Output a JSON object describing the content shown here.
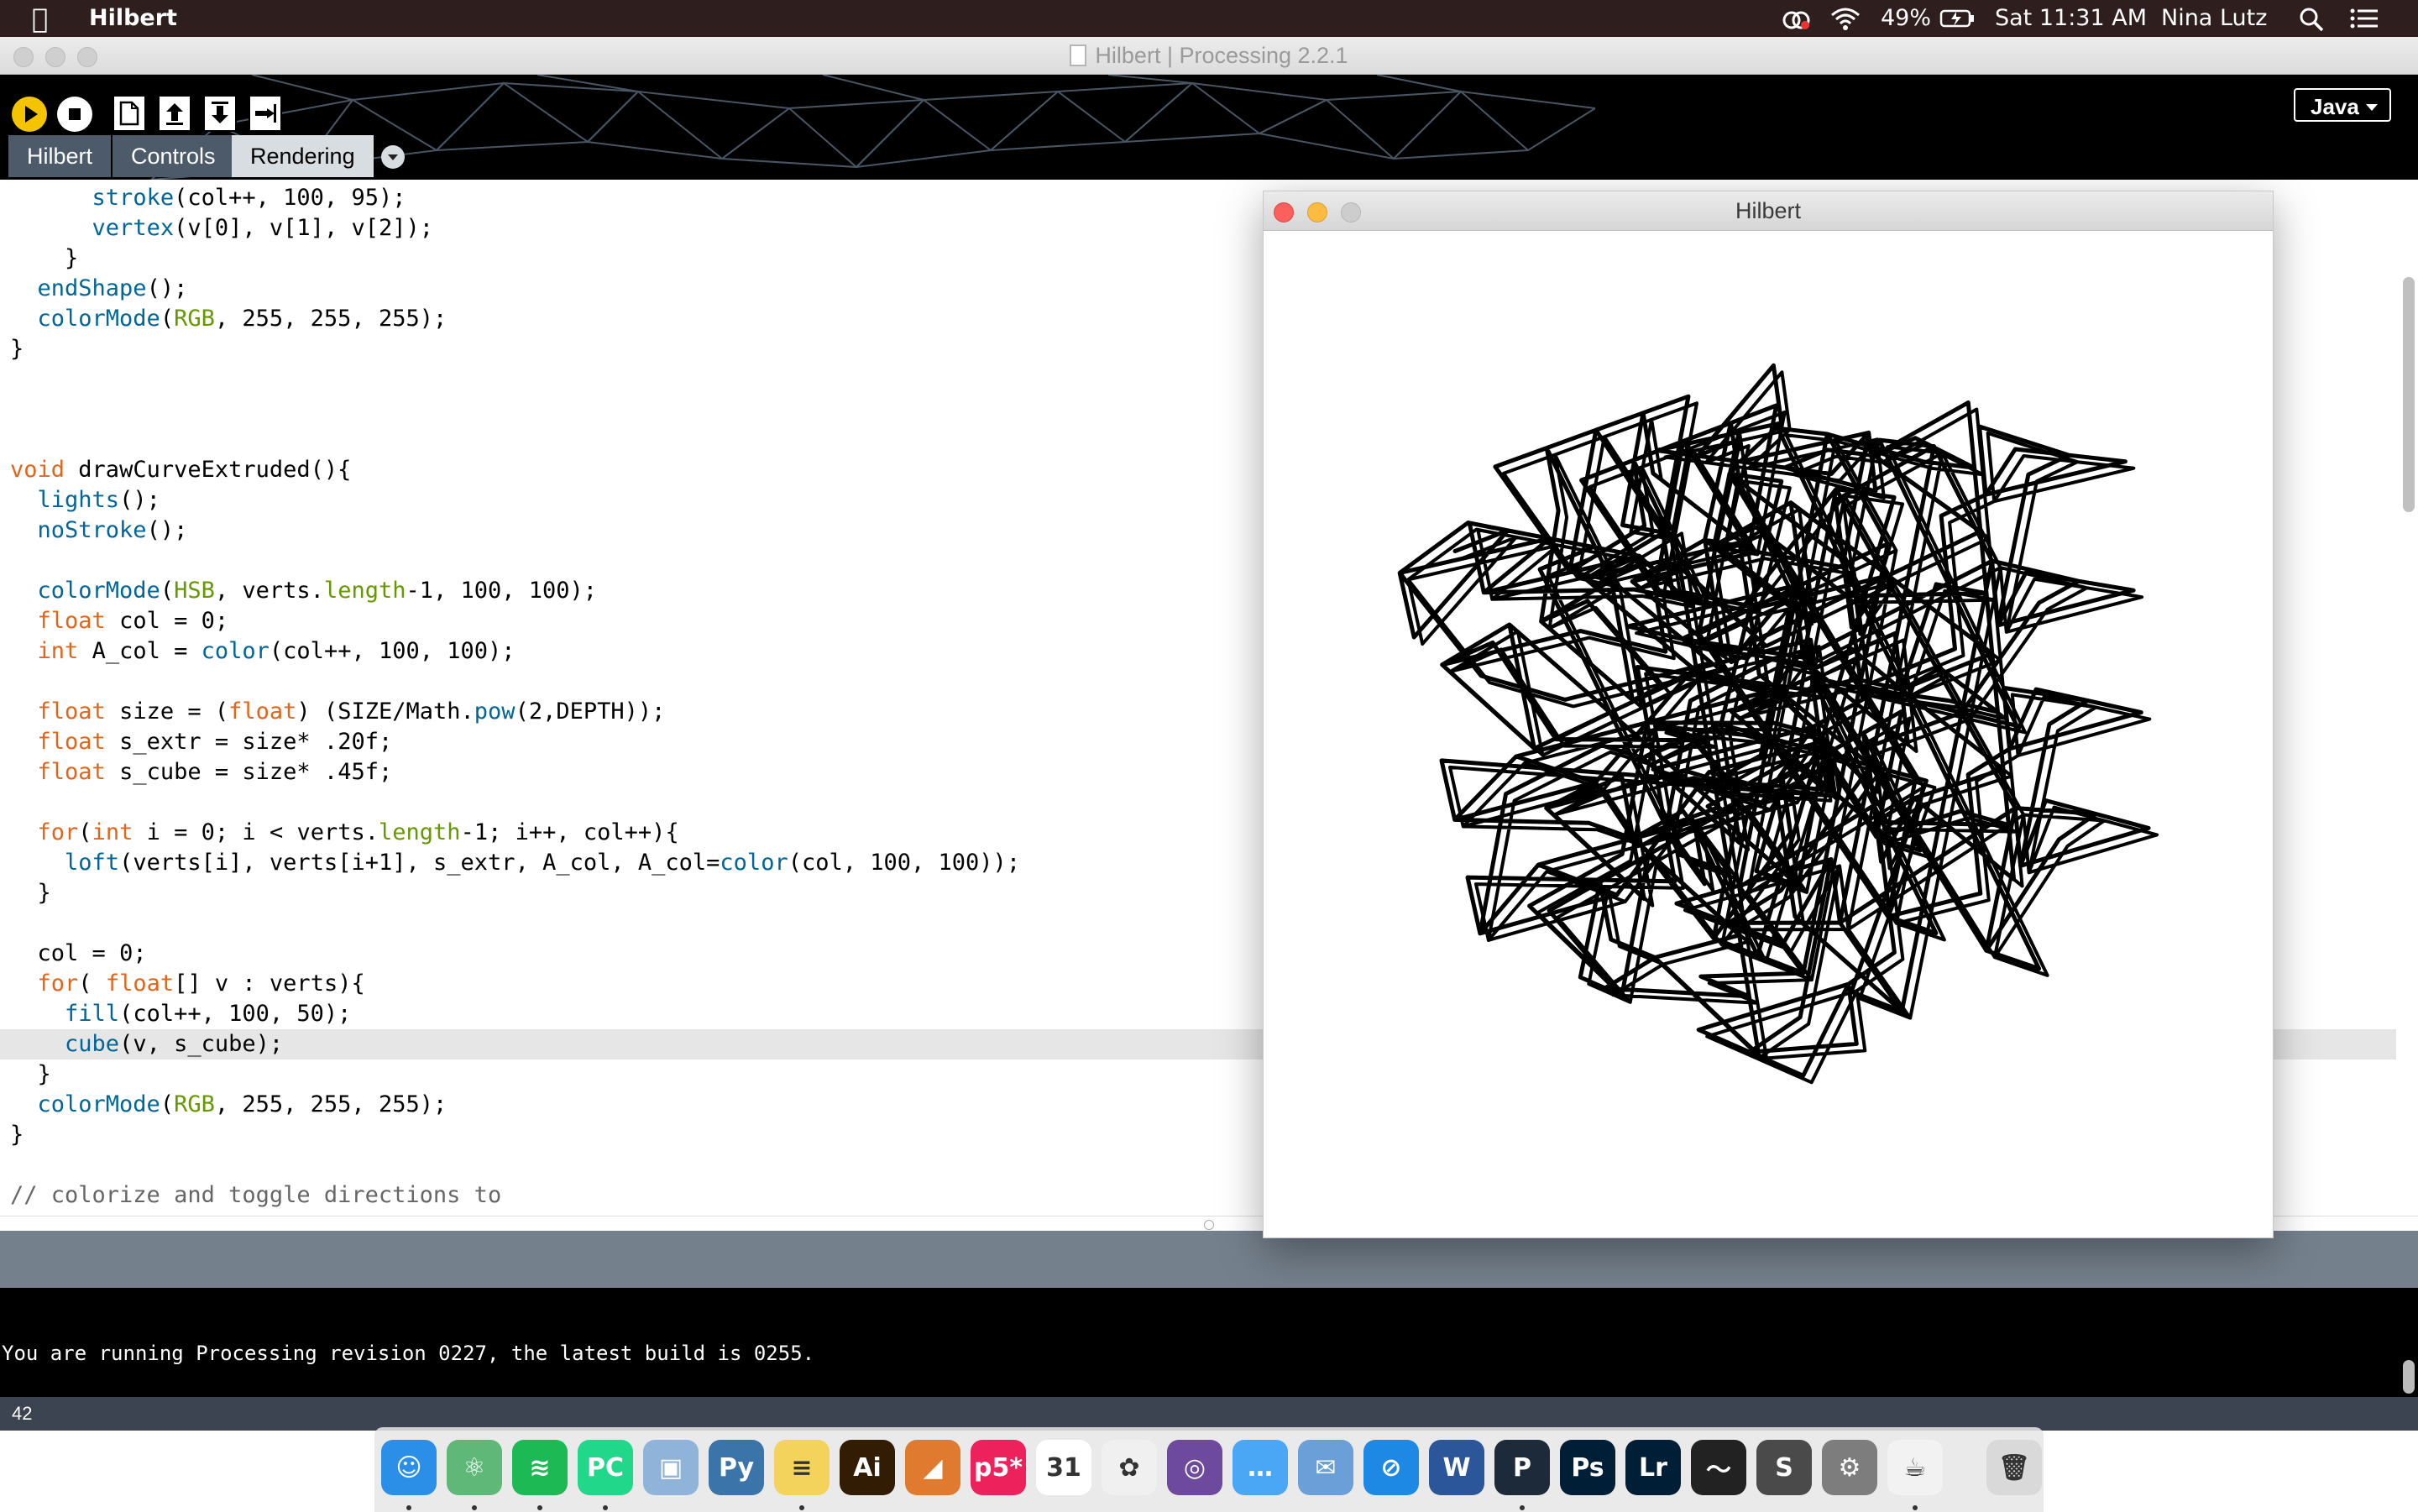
{
  "menubar": {
    "app_name": "Hilbert",
    "battery": "49%",
    "clock": "Sat 11:31 AM",
    "user": "Nina Lutz"
  },
  "window": {
    "title": "Hilbert | Processing 2.2.1"
  },
  "toolbar": {
    "mode": "Java",
    "tabs": [
      {
        "label": "Hilbert",
        "active": false
      },
      {
        "label": "Controls",
        "active": false
      },
      {
        "label": "Rendering",
        "active": true
      }
    ]
  },
  "editor": {
    "highlighted_line": 28,
    "lines": [
      "      stroke(col++, 100, 95);",
      "      vertex(v[0], v[1], v[2]);",
      "    }",
      "  endShape();",
      "  colorMode(RGB, 255, 255, 255);",
      "}",
      "",
      "",
      "",
      "void drawCurveExtruded(){",
      "  lights();",
      "  noStroke();",
      "",
      "  colorMode(HSB, verts.length-1, 100, 100);",
      "  float col = 0;",
      "  int A_col = color(col++, 100, 100);",
      "",
      "  float size = (float) (SIZE/Math.pow(2,DEPTH));",
      "  float s_extr = size* .20f;",
      "  float s_cube = size* .45f;",
      "",
      "  for(int i = 0; i < verts.length-1; i++, col++){",
      "    loft(verts[i], verts[i+1], s_extr, A_col, A_col=color(col, 100, 100));",
      "  }",
      "",
      "  col = 0;",
      "  for( float[] v : verts){",
      "    fill(col++, 100, 50);",
      "    cube(v, s_cube);",
      "  }",
      "  colorMode(RGB, 255, 255, 255);",
      "}",
      "",
      "// colorize and toggle directions to"
    ]
  },
  "console": {
    "message": "You are running Processing revision 0227, the latest build is 0255."
  },
  "status": {
    "line_number": "42"
  },
  "sketch_window": {
    "title": "Hilbert"
  },
  "dock": {
    "apps": [
      {
        "name": "Finder",
        "label": "☺",
        "color": "#2b8fe8"
      },
      {
        "name": "Atom",
        "label": "⚛",
        "color": "#5fb878"
      },
      {
        "name": "Spotify",
        "label": "≋",
        "color": "#1db954"
      },
      {
        "name": "PyCharm",
        "label": "PC",
        "color": "#21d789"
      },
      {
        "name": "Preview",
        "label": "▣",
        "color": "#8fb3d9"
      },
      {
        "name": "Python",
        "label": "Py",
        "color": "#3b74a8"
      },
      {
        "name": "Notes",
        "label": "≡",
        "color": "#f3d35c"
      },
      {
        "name": "Illustrator",
        "label": "Ai",
        "color": "#331c04"
      },
      {
        "name": "MATLAB",
        "label": "◢",
        "color": "#e07a2e"
      },
      {
        "name": "p5",
        "label": "p5*",
        "color": "#ed225d"
      },
      {
        "name": "Calendar",
        "label": "31",
        "color": "#ffffff"
      },
      {
        "name": "Photos",
        "label": "✿",
        "color": "#f0f0f0"
      },
      {
        "name": "GitHub",
        "label": "◎",
        "color": "#6e4a9e"
      },
      {
        "name": "Messages",
        "label": "…",
        "color": "#4aa7f5"
      },
      {
        "name": "Mail",
        "label": "✉",
        "color": "#6a9fd8"
      },
      {
        "name": "Safari",
        "label": "⊘",
        "color": "#1e88e5"
      },
      {
        "name": "Word",
        "label": "W",
        "color": "#2b579a"
      },
      {
        "name": "Processing",
        "label": "P",
        "color": "#1c2a3a"
      },
      {
        "name": "Photoshop",
        "label": "Ps",
        "color": "#001e36"
      },
      {
        "name": "Lightroom",
        "label": "Lr",
        "color": "#001e36"
      },
      {
        "name": "Activity Monitor",
        "label": "〜",
        "color": "#222222"
      },
      {
        "name": "Sublime Text",
        "label": "S",
        "color": "#4a4a4a"
      },
      {
        "name": "System Preferences",
        "label": "⚙",
        "color": "#7d7d7d"
      },
      {
        "name": "Java",
        "label": "☕",
        "color": "#f2f2f2"
      },
      {
        "name": "Trash",
        "label": "🗑",
        "color": "#d9d9d9"
      }
    ]
  }
}
